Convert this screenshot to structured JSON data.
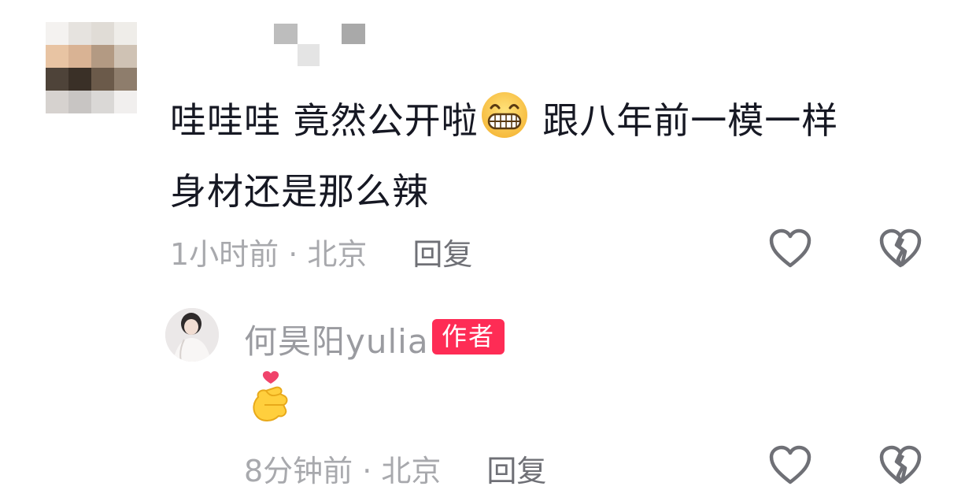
{
  "comment": {
    "text_part1": "哇哇哇  竟然公开啦",
    "emoji": "grin-emoji",
    "text_part2": "  跟八年前一模一样",
    "text_line2": "身材还是那么辣",
    "time": "1小时前 · 北京",
    "reply_label": "回复"
  },
  "reply": {
    "author": "何昊阳yulia",
    "badge": "作者",
    "emoji": "finger-heart-emoji",
    "time": "8分钟前 · 北京",
    "reply_label": "回复"
  },
  "colors": {
    "text": "#161823",
    "meta": "#a8a9ad",
    "badge_bg": "#fe2c55",
    "icon_stroke": "#6f7076"
  }
}
